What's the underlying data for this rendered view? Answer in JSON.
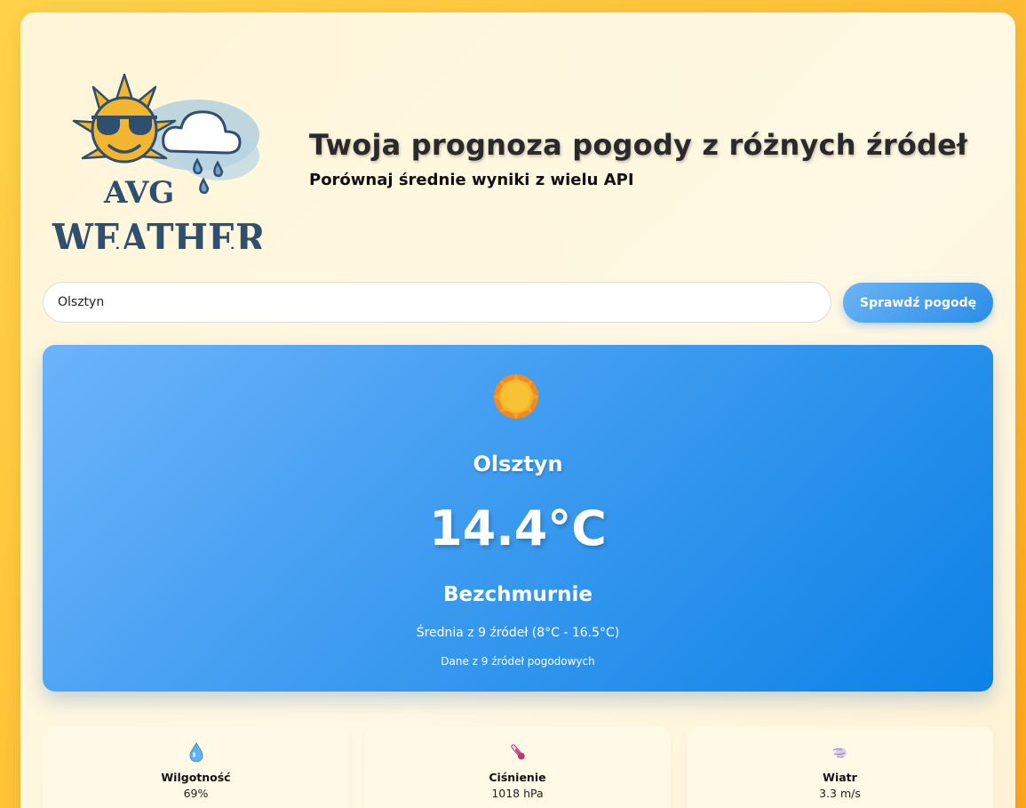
{
  "header": {
    "logo_line1": "AVG",
    "logo_line2": "WEATHER",
    "title": "Twoja prognoza pogody z różnych źródeł",
    "subtitle": "Porównaj średnie wyniki z wielu API"
  },
  "search": {
    "value": "Olsztyn",
    "button_label": "Sprawdź pogodę"
  },
  "weather": {
    "icon": "sun-icon",
    "city": "Olsztyn",
    "temperature": "14.4°C",
    "condition": "Bezchmurnie",
    "average_range": "Średnia z 9 źródeł (8°C - 16.5°C)",
    "sources_note": "Dane z 9 źródeł pogodowych"
  },
  "stats": [
    {
      "icon": "droplet-icon",
      "label": "Wilgotność",
      "value": "69%"
    },
    {
      "icon": "thermometer-icon",
      "label": "Ciśnienie",
      "value": "1018 hPa"
    },
    {
      "icon": "wind-icon",
      "label": "Wiatr",
      "value": "3.3 m/s"
    }
  ],
  "colors": {
    "accent_blue": "#2b8de8",
    "logo_navy": "#2f4f6f",
    "sun_yellow": "#f2b630"
  }
}
